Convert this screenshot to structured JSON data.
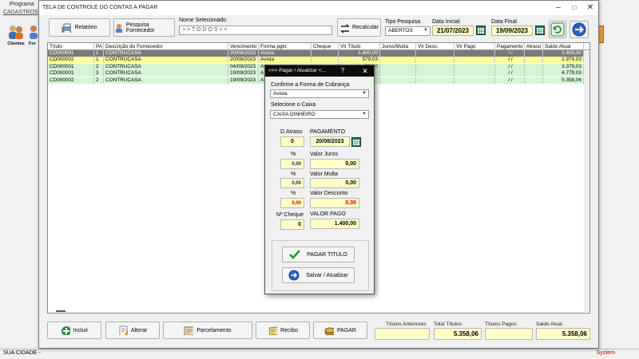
{
  "background": {
    "app_title": "Programa",
    "menu_cadastros": "CADASTROS",
    "tool_clientes": "Clientes",
    "tool_fornecedores": "For",
    "status_city": "SUA CIDADE -",
    "status_system": "System"
  },
  "window": {
    "title": "TELA DE CONTROLE DO CONTAS A PAGAR",
    "relatorio_label": "Relatório",
    "pesquisa_fornecedor_label": "Pesquisa Fornecedor",
    "nome_selecionado_label": "Nome Selecionado",
    "nome_selecionado_value": "> > T O D O S < <",
    "recalcular_label": "Recalcular",
    "tipo_pesquisa_label": "Tipo  Pesquisa",
    "tipo_pesquisa_value": "ABERTOS",
    "data_inicial_label": "Data Inicial",
    "data_inicial_value": "21/07/2023",
    "data_final_label": "Data Final",
    "data_final_value": "19/09/2023"
  },
  "grid": {
    "columns": [
      "Título",
      "PA",
      "Descrição do Fornecedor",
      "Vencimento",
      "Forma pgto",
      "Cheque",
      "Vlr Título",
      "Juros/Multa",
      "Vlr Desc.",
      "Vlr Pago",
      "Pagamento",
      "Atraso",
      "Saldo Atual"
    ],
    "rows": [
      {
        "titulo": "CD000001",
        "pa": "1",
        "fornecedor": "CONTRUCASA",
        "vencimento": "20/08/2023",
        "forma": "Avista",
        "cheque": "",
        "vlr_titulo": "1.400,00",
        "juros": "",
        "desc": "",
        "pago": "",
        "pagamento": "/ /",
        "atraso": "",
        "saldo": "1.400,00",
        "style": "sel"
      },
      {
        "titulo": "CD000002",
        "pa": "1",
        "fornecedor": "CONTRUCASA",
        "vencimento": "20/08/2023",
        "forma": "Avista",
        "cheque": "",
        "vlr_titulo": "579,03",
        "juros": "",
        "desc": "",
        "pago": "",
        "pagamento": "/ /",
        "atraso": "",
        "saldo": "1.979,03",
        "style": "yellow"
      },
      {
        "titulo": "CD000001",
        "pa": "2",
        "fornecedor": "CONTRUCASA",
        "vencimento": "04/09/2023",
        "forma": "Avista",
        "cheque": "",
        "vlr_titulo": "1.400,00",
        "juros": "",
        "desc": "",
        "pago": "",
        "pagamento": "/ /",
        "atraso": "",
        "saldo": "3.379,03",
        "style": "green"
      },
      {
        "titulo": "CD000001",
        "pa": "3",
        "fornecedor": "CONTRUCASA",
        "vencimento": "19/09/2023",
        "forma": "A",
        "cheque": "",
        "vlr_titulo": "",
        "juros": "",
        "desc": "",
        "pago": "",
        "pagamento": "/ /",
        "atraso": "",
        "saldo": "4.779,03",
        "style": "green"
      },
      {
        "titulo": "CD000002",
        "pa": "2",
        "fornecedor": "CONTRUCASA",
        "vencimento": "19/09/2023",
        "forma": "A",
        "cheque": "",
        "vlr_titulo": "",
        "juros": "",
        "desc": "",
        "pago": "",
        "pagamento": "/ /",
        "atraso": "",
        "saldo": "5.358,06",
        "style": "green"
      }
    ]
  },
  "bottom": {
    "incluir": "Incluir",
    "alterar": "Alterar",
    "parcelamento": "Parcelamento",
    "recibo": "Recibo",
    "pagar": "PAGAR",
    "titulos_anteriores_label": "Títulos Anteriores",
    "titulos_anteriores_value": "",
    "total_titulos_label": "Total Títulos",
    "total_titulos_value": "5.358,06",
    "titulos_pagos_label": "Títulos Pagos",
    "titulos_pagos_value": "",
    "saldo_atual_label": "Saldo Atual",
    "saldo_atual_value": "5.358,06"
  },
  "dialog": {
    "title": ">>> Pagar / Atualizar <...",
    "help": "?",
    "close": "X",
    "forma_cobranca_label": "Confirme a Forma de Cobrança",
    "forma_cobranca_value": "Avista",
    "caixa_label": "Selecione o Caixa",
    "caixa_value": "CAIXA DINHEIRO",
    "d_atraso_label": "D.Atraso",
    "d_atraso_value": "0",
    "pagamento_label": "PAGAMENTO",
    "pagamento_value": "20/08/2023",
    "pct_label": "%",
    "juros_pct": "0,00",
    "valor_juros_label": "Valor Juros",
    "valor_juros": "0,00",
    "multa_pct": "0,00",
    "valor_multa_label": "Valor Multa",
    "valor_multa": "0,00",
    "desconto_pct": "0,00",
    "valor_desconto_label": "Valor Desconto",
    "valor_desconto": "0,00",
    "n_cheque_label": "Nº Cheque",
    "n_cheque_value": "0",
    "valor_pago_label": "VALOR PAGO",
    "valor_pago_value": "1.400,00",
    "pagar_titulo_label": "PAGAR TITULO",
    "salvar_label": "Salvar / Atualizar"
  },
  "colors": {
    "selected_row": "#7a7a7a",
    "yellow_row": "#ffff99",
    "green_row": "#d4f5d4",
    "field_yellow": "#ffffc6",
    "desconto_red": "#d00000"
  }
}
